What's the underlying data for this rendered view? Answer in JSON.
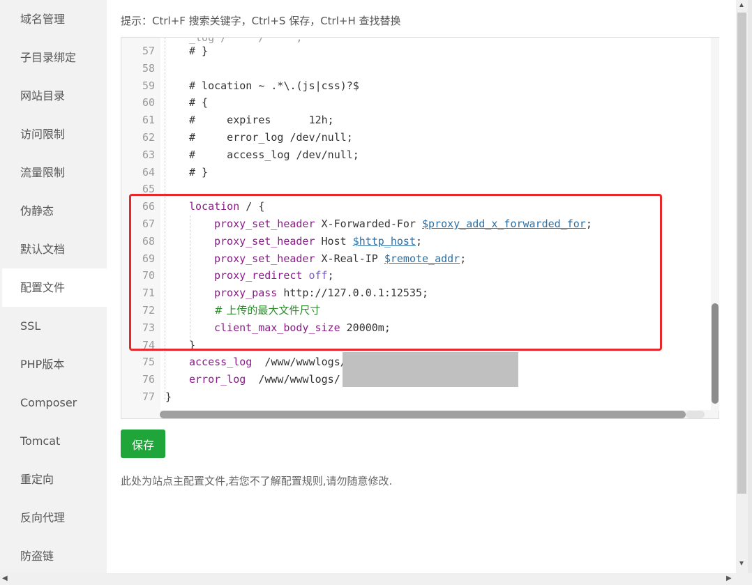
{
  "sidebar": {
    "items": [
      {
        "label": "域名管理"
      },
      {
        "label": "子目录绑定"
      },
      {
        "label": "网站目录"
      },
      {
        "label": "访问限制"
      },
      {
        "label": "流量限制"
      },
      {
        "label": "伪静态"
      },
      {
        "label": "默认文档"
      },
      {
        "label": "配置文件",
        "active": true
      },
      {
        "label": "SSL"
      },
      {
        "label": "PHP版本"
      },
      {
        "label": "Composer"
      },
      {
        "label": "Tomcat"
      },
      {
        "label": "重定向"
      },
      {
        "label": "反向代理"
      },
      {
        "label": "防盗链"
      }
    ]
  },
  "hint": "提示：Ctrl+F 搜索关键字，Ctrl+S 保存，Ctrl+H 查找替换",
  "editor": {
    "lines": [
      {
        "n": "57",
        "text": "# }"
      },
      {
        "n": "58",
        "text": ""
      },
      {
        "n": "59",
        "text": "# location ~ .*\\.(js|css)?$"
      },
      {
        "n": "60",
        "text": "# {"
      },
      {
        "n": "61",
        "text": "#     expires      12h;"
      },
      {
        "n": "62",
        "text": "#     error_log /dev/null;"
      },
      {
        "n": "63",
        "text": "#     access_log /dev/null;"
      },
      {
        "n": "64",
        "text": "# }"
      },
      {
        "n": "65",
        "text": ""
      },
      {
        "n": "66",
        "kw": "location",
        "rest": " / {"
      },
      {
        "n": "67",
        "kw": "proxy_set_header",
        "rest": " X-Forwarded-For ",
        "var": "$proxy_add_x_forwarded_for",
        "tail": ";"
      },
      {
        "n": "68",
        "kw": "proxy_set_header",
        "rest": " Host ",
        "var": "$http_host",
        "tail": ";"
      },
      {
        "n": "69",
        "kw": "proxy_set_header",
        "rest": " X-Real-IP ",
        "var": "$remote_addr",
        "tail": ";"
      },
      {
        "n": "70",
        "kw": "proxy_redirect",
        "val": " off",
        "tail": ";"
      },
      {
        "n": "71",
        "kw": "proxy_pass",
        "rest": " http://127.0.0.1:12535;"
      },
      {
        "n": "72",
        "zh": "# 上传的最大文件尺寸"
      },
      {
        "n": "73",
        "kw": "client_max_body_size",
        "rest": " 20000m;"
      },
      {
        "n": "74",
        "text": "}"
      },
      {
        "n": "75",
        "kw": "access_log",
        "rest": "  /www/wwwlogs/"
      },
      {
        "n": "76",
        "kw": "error_log",
        "rest": "  /www/wwwlogs/"
      },
      {
        "n": "77",
        "text": "}"
      }
    ]
  },
  "save_label": "保存",
  "note": "此处为站点主配置文件,若您不了解配置规则,请勿随意修改.",
  "colors": {
    "save": "#20a53a",
    "highlight_box": "#e8272b",
    "keyword": "#8b1b8a",
    "variable": "#2e6fa3"
  }
}
